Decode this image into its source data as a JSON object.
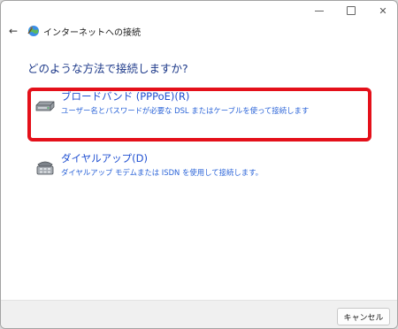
{
  "window": {
    "title": "インターネットへの接続"
  },
  "caption": {
    "close_glyph": "✕"
  },
  "nav": {
    "back_glyph": "←"
  },
  "heading": "どのような方法で接続しますか?",
  "options": [
    {
      "title": "ブロードバンド (PPPoE)(R)",
      "description": "ユーザー名とパスワードが必要な DSL またはケーブルを使って接続します",
      "icon": "broadband-modem-icon",
      "highlighted": true
    },
    {
      "title": "ダイヤルアップ(D)",
      "description": "ダイヤルアップ モデムまたは ISDN を使用して接続します。",
      "icon": "dialup-phone-icon",
      "highlighted": false
    }
  ],
  "footer": {
    "cancel_label": "キャンセル"
  },
  "colors": {
    "link_blue": "#1f4fd1",
    "heading_blue": "#1e3a8a",
    "highlight_red": "#e4101a"
  }
}
